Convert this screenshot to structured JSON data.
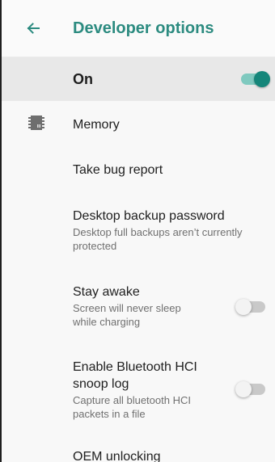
{
  "appbar": {
    "title": "Developer options",
    "back_icon": "arrow-back-icon"
  },
  "master_switch": {
    "label": "On",
    "checked": true
  },
  "items": [
    {
      "title": "Memory",
      "icon": "memory-chip-icon"
    },
    {
      "title": "Take bug report"
    },
    {
      "title": "Desktop backup password",
      "subtitle_line1": "Desktop full backups aren’t currently",
      "subtitle_line2": "protected"
    },
    {
      "title": "Stay awake",
      "subtitle_line1": "Screen will never sleep",
      "subtitle_line2": "while charging",
      "checked": false
    },
    {
      "title_line1": "Enable Bluetooth HCI",
      "title_line2": "snoop log",
      "subtitle_line1": "Capture all bluetooth HCI",
      "subtitle_line2": "packets in a file",
      "checked": false
    },
    {
      "title": "OEM unlocking"
    }
  ],
  "colors": {
    "accent": "#2c8b80",
    "switch_on_thumb": "#15867a",
    "switch_on_track": "#7fc9bf",
    "switch_off_track": "#c9c9c9"
  }
}
